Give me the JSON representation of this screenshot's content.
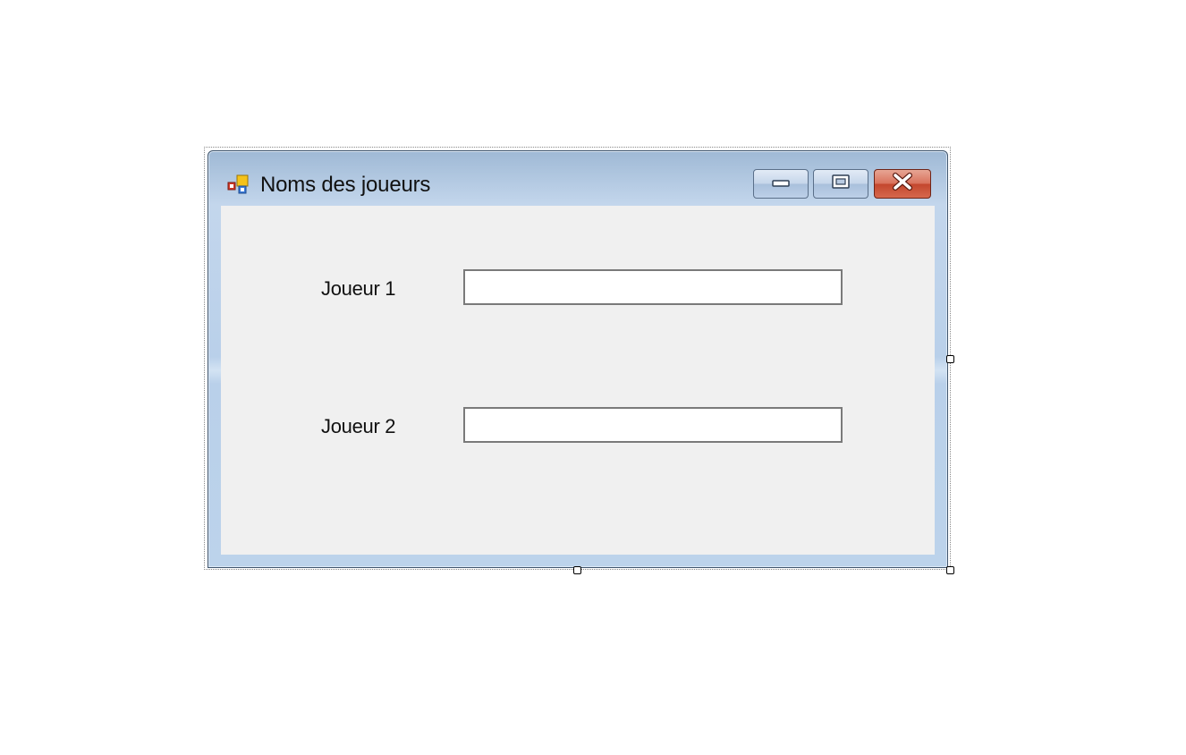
{
  "window": {
    "title": "Noms des joueurs",
    "icon": "windows-form-icon",
    "caption_buttons": [
      "minimize-icon",
      "maximize-icon",
      "close-icon"
    ]
  },
  "form": {
    "fields": [
      {
        "label": "Joueur 1",
        "value": "",
        "placeholder": ""
      },
      {
        "label": "Joueur 2",
        "value": "",
        "placeholder": ""
      }
    ]
  },
  "colors": {
    "titlebar": "#b9d0ea",
    "client_background": "#f0f0f0",
    "close_button": "#c3472e"
  }
}
